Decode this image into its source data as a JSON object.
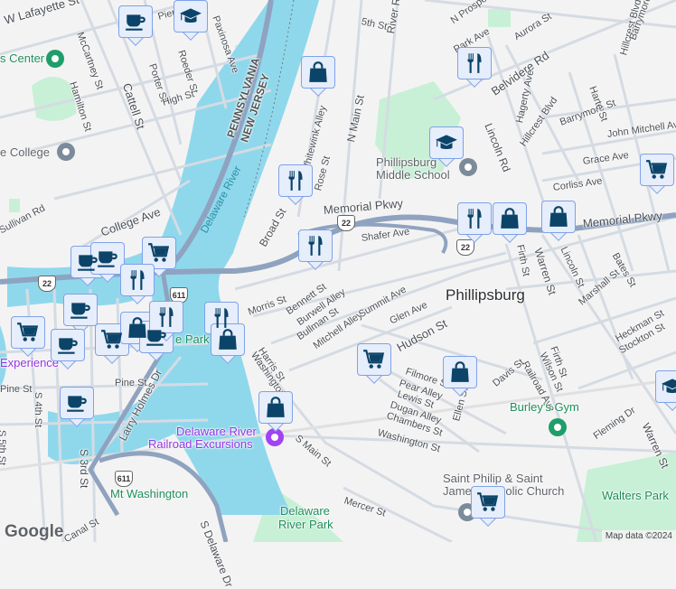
{
  "map": {
    "attribution": "Map data ©2024",
    "logo": "Google",
    "city": "Phillipsburg",
    "state_border": {
      "upper": "PENNSYLVANIA",
      "lower": "NEW JERSEY"
    },
    "places": {
      "arts_center": "s Center",
      "college": "e College",
      "middle_school": [
        "Phillipsburg",
        "Middle School"
      ],
      "railroad": [
        "Delaware River",
        "Railroad Excursions"
      ],
      "gym": "Burley's Gym",
      "church": [
        "Saint Philip & Saint",
        "James Catholic Church"
      ],
      "walters_park": "Walters Park",
      "mt_washington": "Mt Washington",
      "delaware_park": [
        "Delaware",
        "River Park"
      ],
      "experience": "Experience",
      "park_partial": "e Park"
    },
    "water": "Delaware River",
    "routes": [
      "22",
      "22",
      "22",
      "611",
      "611"
    ],
    "streets": [
      "W Lafayette St",
      "McCartney St",
      "Cattell St",
      "Porter St",
      "Roeder St",
      "Pierce St",
      "Paxinosa Ave",
      "Hamilton St",
      "High St",
      "College Ave",
      "Sullivan Rd",
      "Broad St",
      "Memorial Pkwy",
      "Memorial Pkwy",
      "5th St",
      "River Rd",
      "N Main St",
      "N Prospect St",
      "Park Ave",
      "Aurora St",
      "Belvidere Rd",
      "Lincoln Rd",
      "Hagerty Ave",
      "Hillcrest Blvd",
      "Barrymore St",
      "Harte St",
      "John Mitchell Ave",
      "Grace Ave",
      "Corliss Ave",
      "Shafer Ave",
      "Bates St",
      "Hillcrest Blvd",
      "Whitewink Alley",
      "Rose St",
      "Morris St",
      "Bennett St",
      "Burwell Alley",
      "Bullman St",
      "Mitchell Alley",
      "Summit Ave",
      "Glen Ave",
      "Hudson St",
      "Warren St",
      "Firth St",
      "Firth St",
      "Lincoln St",
      "Marshall St",
      "Heckman St",
      "Stockton St",
      "Wilson St",
      "Railroad Ave",
      "Davis St",
      "Filmore St",
      "Pear Alley",
      "Lewis St",
      "Dugan Alley",
      "Chambers St",
      "Ellen St",
      "Washington St",
      "Fleming Dr",
      "Warren St",
      "Harris St",
      "Washington St",
      "S Main St",
      "Mercer St",
      "Pine St",
      "Pine St",
      "S 4th St",
      "S 5th St",
      "S 3rd St",
      "Larry Holmes Dr",
      "S Delaware Dr",
      "Canal St",
      "Barrymore St"
    ]
  },
  "markers": [
    "coffee-icon",
    "school-icon",
    "shopping-icon",
    "restaurant-icon",
    "restaurant-icon",
    "restaurant-icon",
    "school-icon",
    "restaurant-icon",
    "shopping-icon",
    "shopping-icon",
    "grocery-icon",
    "coffee-icon",
    "coffee-icon",
    "grocery-icon",
    "restaurant-icon",
    "coffee-icon",
    "grocery-icon",
    "coffee-icon",
    "grocery-icon",
    "shopping-icon",
    "coffee-icon",
    "restaurant-icon",
    "restaurant-icon",
    "shopping-icon",
    "coffee-icon",
    "shopping-icon",
    "grocery-icon",
    "shopping-icon",
    "school-icon",
    "grocery-icon"
  ],
  "colors": {
    "water": "#8fd8ec",
    "park": "#c8f0d6",
    "highway": "#8fa3c0",
    "marker_icon": "#0b4468",
    "marker_bg": "#e6edfb"
  }
}
